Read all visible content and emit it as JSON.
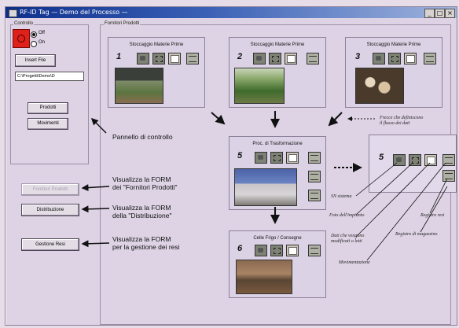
{
  "window": {
    "title": "RF-ID Tag — Demo del Processo —",
    "min": "_",
    "max": "□",
    "close": "×"
  },
  "controllo": {
    "label": "Controllo",
    "radio_on": "Off",
    "radio_off": "On",
    "insert_btn": "Insert File",
    "path": "C:\\Progetti\\Demo\\D",
    "prodotti_btn": "Prodotti",
    "movimenti_btn": "Movimenti"
  },
  "fornitori_label": "Fornitori Prodotti",
  "panels": {
    "p1": {
      "title": "Stoccaggio Materie Prime",
      "num": "1"
    },
    "p2": {
      "title": "Stoccaggio Materie Prime",
      "num": "2"
    },
    "p3": {
      "title": "Stoccaggio Materie Prime",
      "num": "3"
    },
    "p5": {
      "title": "Proc. di Trasformazione",
      "num": "5"
    },
    "p6": {
      "title": "Celle Frigo / Consegne",
      "num": "6"
    },
    "pz": {
      "num": "5"
    }
  },
  "buttons": {
    "fornitori": "Fornitori Prodotti",
    "distribuzione": "Distribuzione",
    "gestione": "Gestione Resi"
  },
  "captions": {
    "pannello": "Pannello di controllo",
    "forn_1": "Visualizza la FORM",
    "forn_2": "dei \"Fornitori Prodotti\"",
    "dist_1": "Visualizza la FORM",
    "dist_2": "della \"Distribuzione\"",
    "gest_1": "Visualizza la FORM",
    "gest_2": "per la gestione dei resi"
  },
  "annotations": {
    "flusso_1": "Frecce che definiscono",
    "flusso_2": "il flusso dei dati",
    "sn": "SN sistema",
    "impianto": "Foto dell'impianto",
    "dati_1": "Dati che vengono",
    "dati_2": "modificati o letti",
    "movim": "Movimentazione",
    "registro": "Registro resi",
    "magazzino": "Registro di magazzino"
  }
}
